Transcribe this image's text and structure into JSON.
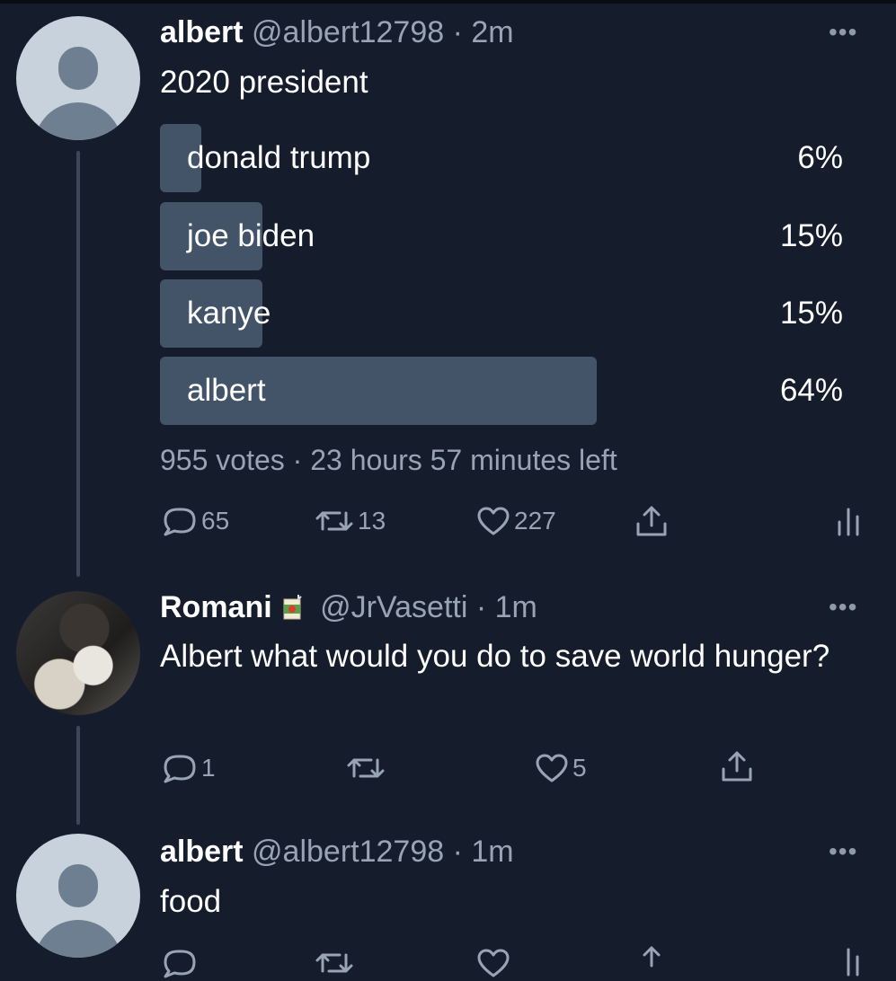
{
  "tweets": [
    {
      "name": "albert",
      "handle": "@albert12798",
      "time": "2m",
      "text": "2020 president",
      "poll": {
        "options": [
          {
            "label": "donald trump",
            "percent_text": "6%",
            "percent": 6
          },
          {
            "label": "joe biden",
            "percent_text": "15%",
            "percent": 15
          },
          {
            "label": "kanye",
            "percent_text": "15%",
            "percent": 15
          },
          {
            "label": "albert",
            "percent_text": "64%",
            "percent": 64
          }
        ],
        "votes": "955 votes",
        "time_left": "23 hours 57 minutes left"
      },
      "actions": {
        "replies": "65",
        "retweets": "13",
        "likes": "227"
      }
    },
    {
      "name": "Romani",
      "emoji": "juice-box-emoji",
      "handle": "@JrVasetti",
      "time": "1m",
      "text": "Albert what would you do to save world hunger?",
      "actions": {
        "replies": "1",
        "retweets": "",
        "likes": "5"
      }
    },
    {
      "name": "albert",
      "handle": "@albert12798",
      "time": "1m",
      "text": "food"
    }
  ],
  "separator": " · ",
  "more_glyph": "•••",
  "colors": {
    "background": "#151c2c",
    "poll_fill": "#435469",
    "secondary_text": "#98a4b3",
    "thread_line": "#3c4859"
  },
  "icons": [
    "reply-icon",
    "retweet-icon",
    "like-icon",
    "share-icon",
    "analytics-icon",
    "more-icon"
  ]
}
